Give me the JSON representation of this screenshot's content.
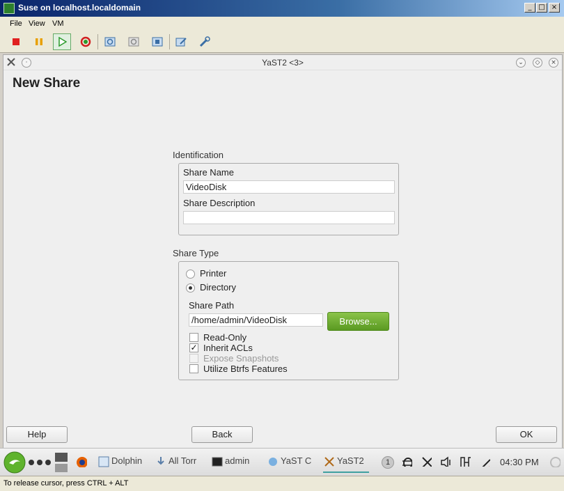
{
  "window": {
    "title": "Suse on localhost.localdomain"
  },
  "menubar": {
    "items": [
      "File",
      "View",
      "VM"
    ]
  },
  "toolbar": {
    "icons": [
      "stop-icon",
      "pause-icon",
      "play-icon",
      "reset-icon",
      "snapshot-icon",
      "revert-snapshot-icon",
      "snapshot-manager-icon",
      "settings-icon",
      "tools-icon"
    ]
  },
  "yast_window": {
    "title": "YaST2 <3>"
  },
  "page": {
    "title": "New Share"
  },
  "identification": {
    "label": "Identification",
    "share_name_label": "Share Name",
    "share_name_value": "VideoDisk",
    "share_description_label": "Share Description",
    "share_description_value": ""
  },
  "share_type": {
    "label": "Share Type",
    "printer_label": "Printer",
    "directory_label": "Directory",
    "selected": "Directory",
    "share_path_label": "Share Path",
    "share_path_value": "/home/admin/VideoDisk",
    "browse_label": "Browse...",
    "options": [
      {
        "label": "Read-Only",
        "checked": false,
        "disabled": false
      },
      {
        "label": "Inherit ACLs",
        "checked": true,
        "disabled": false
      },
      {
        "label": "Expose Snapshots",
        "checked": false,
        "disabled": true
      },
      {
        "label": "Utilize Btrfs Features",
        "checked": false,
        "disabled": false
      }
    ]
  },
  "buttons": {
    "help": "Help",
    "back": "Back",
    "ok": "OK"
  },
  "taskbar": {
    "items": [
      "Dolphin",
      "All Torr",
      "admin",
      "YaST Co",
      "YaST2"
    ],
    "badge": "1",
    "clock": "04:30 PM"
  },
  "statusbar": {
    "text": "To release cursor, press CTRL + ALT"
  },
  "colors": {
    "browse_button": "#6aa82f",
    "title_bar": "#0a246a",
    "stop": "#e02020",
    "pause": "#e8a000",
    "play": "#2a9a2a"
  }
}
